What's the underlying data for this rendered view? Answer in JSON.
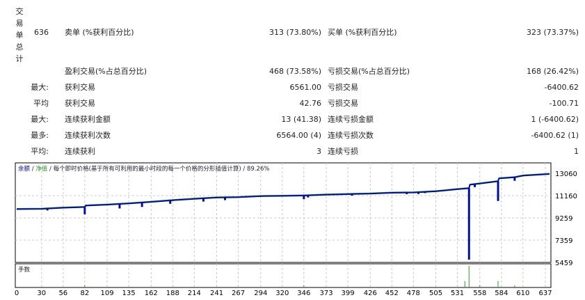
{
  "section_label": "交易单总计",
  "rows": [
    {
      "c1": "636",
      "c2": "卖单 (%获利百分比)",
      "c3": "313 (73.80%)",
      "c4": "买单 (%获利百分比)",
      "c5": "323 (73.37%)"
    },
    {
      "c1": "",
      "c2": "盈利交易(%占总百分比)",
      "c3": "468 (73.58%)",
      "c4": "亏损交易(%占总百分比)",
      "c5": "168 (26.42%)"
    },
    {
      "c1": "最大:",
      "c2": "获利交易",
      "c3": "6561.00",
      "c4": "亏损交易",
      "c5": "-6400.62"
    },
    {
      "c1": "平均",
      "c2": "获利交易",
      "c3": "42.76",
      "c4": "亏损交易",
      "c5": "-100.71"
    },
    {
      "c1": "最大:",
      "c2": "连续获利金额",
      "c3": "13 (41.38)",
      "c4": "连续亏损金额",
      "c5": "1 (-6400.62)"
    },
    {
      "c1": "最多:",
      "c2": "连续获利次数",
      "c3": "6564.00 (4)",
      "c4": "连续亏损次数",
      "c5": "-6400.62 (1)"
    },
    {
      "c1": "平均:",
      "c2": "连续获利",
      "c3": "3",
      "c4": "连续亏损",
      "c5": "1"
    }
  ],
  "chart_data": {
    "type": "line",
    "legend": {
      "balance": "余额",
      "sep1": " / ",
      "equity": "净值",
      "sep2": " / ",
      "model": "每个即时价格(基于所有可利用的最小时段的每一个价格的分形插值计算)",
      "sep3": " / ",
      "quality": "89.26%"
    },
    "volume_label": "手数",
    "ylim": [
      5459,
      13900
    ],
    "xlim": [
      0,
      642
    ],
    "y_ticks": [
      "13060",
      "11160",
      "9259",
      "7359",
      "5459"
    ],
    "x_ticks": [
      "0",
      "30",
      "56",
      "82",
      "109",
      "135",
      "162",
      "188",
      "214",
      "241",
      "267",
      "294",
      "320",
      "346",
      "373",
      "399",
      "426",
      "452",
      "478",
      "505",
      "531",
      "558",
      "584",
      "610",
      "637"
    ],
    "colors": {
      "balance": "#00109c",
      "equity": "#2a9a2a",
      "grid": "#c8c8c8"
    },
    "balance": [
      [
        0,
        10000
      ],
      [
        30,
        10020
      ],
      [
        56,
        10120
      ],
      [
        82,
        10180
      ],
      [
        83,
        10300
      ],
      [
        109,
        10380
      ],
      [
        135,
        10480
      ],
      [
        162,
        10620
      ],
      [
        188,
        10760
      ],
      [
        214,
        10880
      ],
      [
        241,
        10990
      ],
      [
        267,
        11020
      ],
      [
        294,
        11110
      ],
      [
        320,
        11130
      ],
      [
        346,
        11160
      ],
      [
        373,
        11230
      ],
      [
        399,
        11280
      ],
      [
        426,
        11320
      ],
      [
        452,
        11400
      ],
      [
        478,
        11420
      ],
      [
        505,
        11520
      ],
      [
        531,
        11700
      ],
      [
        545,
        11780
      ],
      [
        546,
        12080
      ],
      [
        558,
        12180
      ],
      [
        580,
        12380
      ],
      [
        581,
        12620
      ],
      [
        600,
        12720
      ],
      [
        610,
        12860
      ],
      [
        637,
        12980
      ],
      [
        642,
        13000
      ]
    ],
    "dips": [
      [
        37,
        9890
      ],
      [
        82,
        9560
      ],
      [
        124,
        10060
      ],
      [
        151,
        10190
      ],
      [
        185,
        10460
      ],
      [
        225,
        10650
      ],
      [
        251,
        10770
      ],
      [
        346,
        10850
      ],
      [
        351,
        11000
      ],
      [
        404,
        11150
      ],
      [
        470,
        11280
      ],
      [
        484,
        11290
      ],
      [
        492,
        11370
      ],
      [
        545,
        5700
      ],
      [
        552,
        11880
      ],
      [
        580,
        10700
      ],
      [
        600,
        12420
      ]
    ],
    "volume": [
      [
        82,
        0.1
      ],
      [
        346,
        0.1
      ],
      [
        540,
        0.3
      ],
      [
        545,
        1
      ],
      [
        558,
        0.1
      ],
      [
        580,
        0.3
      ],
      [
        600,
        0.1
      ]
    ]
  }
}
